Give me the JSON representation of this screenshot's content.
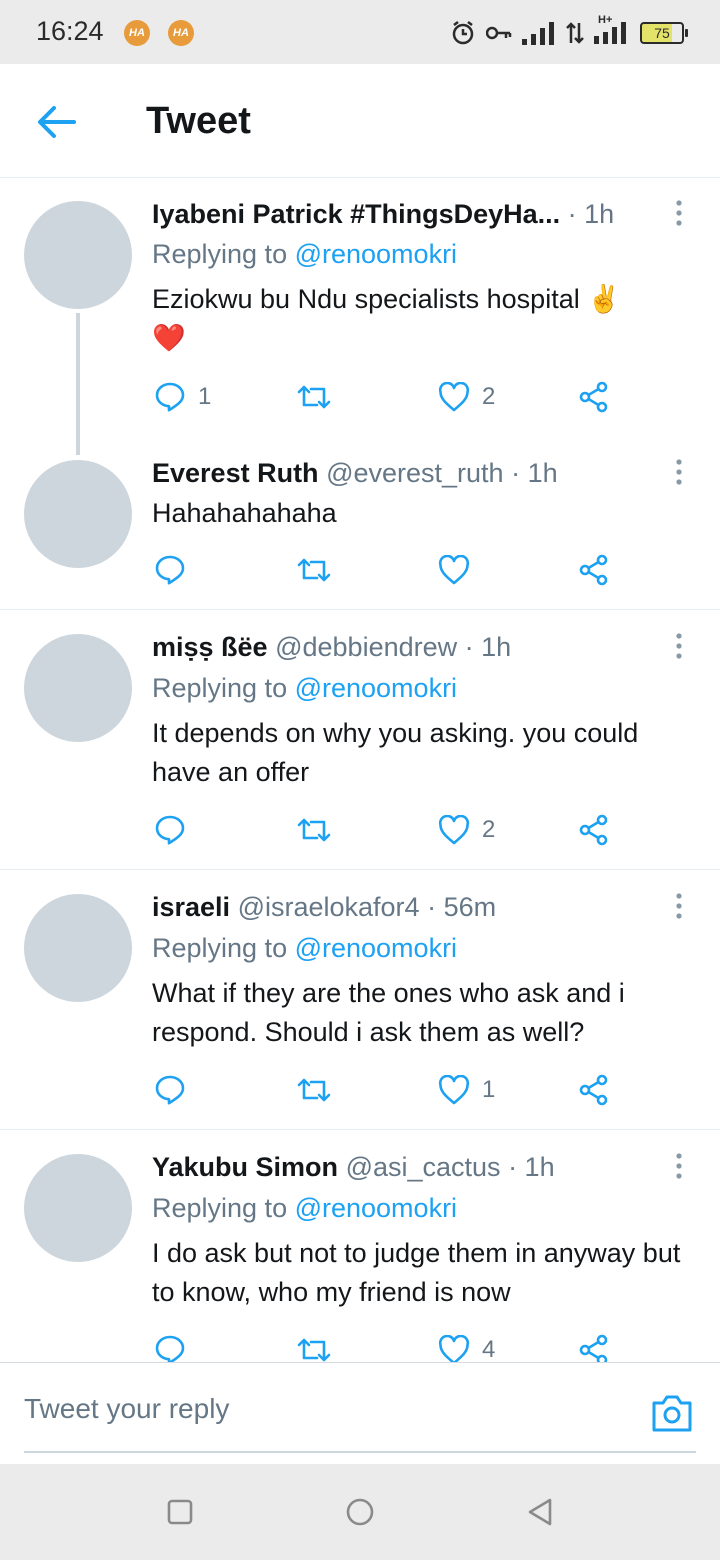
{
  "status_bar": {
    "time": "16:24",
    "notification_badge_1": "HA",
    "notification_badge_2": "HA",
    "network_type": "H+",
    "battery_level": "75"
  },
  "header": {
    "title": "Tweet"
  },
  "tweets": [
    {
      "name": "Iyabeni Patrick #ThingsDeyHa...",
      "handle": "",
      "time": "· 1h",
      "replying_label": "Replying to ",
      "replying_to": "@renoomokri",
      "body": "Eziokwu bu Ndu specialists hospital ✌️ ❤️",
      "reply_count": "1",
      "retweet_count": "",
      "like_count": "2"
    },
    {
      "name": "Everest Ruth",
      "handle": "@everest_ruth",
      "time": "· 1h",
      "body": "Hahahahahaha",
      "reply_count": "",
      "retweet_count": "",
      "like_count": ""
    },
    {
      "name": "miṣṣ ßëe",
      "handle": "@debbiendrew",
      "time": "· 1h",
      "replying_label": "Replying to ",
      "replying_to": "@renoomokri",
      "body": "It depends on why you asking. you could have an offer",
      "reply_count": "",
      "retweet_count": "",
      "like_count": "2"
    },
    {
      "name": "israeli",
      "handle": "@israelokafor4",
      "time": "· 56m",
      "replying_label": "Replying to ",
      "replying_to": "@renoomokri",
      "body": "What if they are the ones who ask  and i respond. Should i ask them as well?",
      "reply_count": "",
      "retweet_count": "",
      "like_count": "1"
    },
    {
      "name": "Yakubu Simon",
      "handle": "@asi_cactus",
      "time": "· 1h",
      "replying_label": "Replying to ",
      "replying_to": "@renoomokri",
      "body": "I do ask but not to judge them in anyway but to know, who my friend is now",
      "reply_count": "",
      "retweet_count": "",
      "like_count": "4"
    }
  ],
  "reply_bar": {
    "placeholder": "Tweet your reply"
  },
  "icons": {
    "back": "arrow-left-icon",
    "more": "more-vertical-icon",
    "reply": "reply-bubble-icon",
    "retweet": "retweet-icon",
    "like": "heart-icon",
    "share": "share-icon",
    "camera": "camera-icon"
  },
  "colors": {
    "accent": "#1da1f2",
    "secondary_text": "#657786",
    "primary_text": "#14171a",
    "avatar_placeholder": "#cdd6dd"
  }
}
